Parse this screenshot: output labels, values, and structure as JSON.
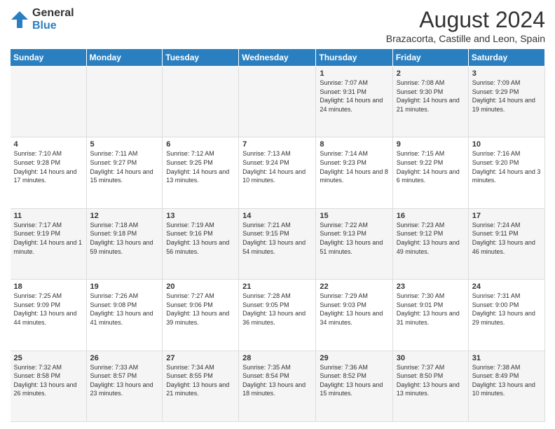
{
  "header": {
    "logo": {
      "general": "General",
      "blue": "Blue"
    },
    "title": "August 2024",
    "subtitle": "Brazacorta, Castille and Leon, Spain"
  },
  "calendar": {
    "days_of_week": [
      "Sunday",
      "Monday",
      "Tuesday",
      "Wednesday",
      "Thursday",
      "Friday",
      "Saturday"
    ],
    "weeks": [
      [
        {
          "day": "",
          "info": ""
        },
        {
          "day": "",
          "info": ""
        },
        {
          "day": "",
          "info": ""
        },
        {
          "day": "",
          "info": ""
        },
        {
          "day": "1",
          "info": "Sunrise: 7:07 AM\nSunset: 9:31 PM\nDaylight: 14 hours and 24 minutes."
        },
        {
          "day": "2",
          "info": "Sunrise: 7:08 AM\nSunset: 9:30 PM\nDaylight: 14 hours and 21 minutes."
        },
        {
          "day": "3",
          "info": "Sunrise: 7:09 AM\nSunset: 9:29 PM\nDaylight: 14 hours and 19 minutes."
        }
      ],
      [
        {
          "day": "4",
          "info": "Sunrise: 7:10 AM\nSunset: 9:28 PM\nDaylight: 14 hours and 17 minutes."
        },
        {
          "day": "5",
          "info": "Sunrise: 7:11 AM\nSunset: 9:27 PM\nDaylight: 14 hours and 15 minutes."
        },
        {
          "day": "6",
          "info": "Sunrise: 7:12 AM\nSunset: 9:25 PM\nDaylight: 14 hours and 13 minutes."
        },
        {
          "day": "7",
          "info": "Sunrise: 7:13 AM\nSunset: 9:24 PM\nDaylight: 14 hours and 10 minutes."
        },
        {
          "day": "8",
          "info": "Sunrise: 7:14 AM\nSunset: 9:23 PM\nDaylight: 14 hours and 8 minutes."
        },
        {
          "day": "9",
          "info": "Sunrise: 7:15 AM\nSunset: 9:22 PM\nDaylight: 14 hours and 6 minutes."
        },
        {
          "day": "10",
          "info": "Sunrise: 7:16 AM\nSunset: 9:20 PM\nDaylight: 14 hours and 3 minutes."
        }
      ],
      [
        {
          "day": "11",
          "info": "Sunrise: 7:17 AM\nSunset: 9:19 PM\nDaylight: 14 hours and 1 minute."
        },
        {
          "day": "12",
          "info": "Sunrise: 7:18 AM\nSunset: 9:18 PM\nDaylight: 13 hours and 59 minutes."
        },
        {
          "day": "13",
          "info": "Sunrise: 7:19 AM\nSunset: 9:16 PM\nDaylight: 13 hours and 56 minutes."
        },
        {
          "day": "14",
          "info": "Sunrise: 7:21 AM\nSunset: 9:15 PM\nDaylight: 13 hours and 54 minutes."
        },
        {
          "day": "15",
          "info": "Sunrise: 7:22 AM\nSunset: 9:13 PM\nDaylight: 13 hours and 51 minutes."
        },
        {
          "day": "16",
          "info": "Sunrise: 7:23 AM\nSunset: 9:12 PM\nDaylight: 13 hours and 49 minutes."
        },
        {
          "day": "17",
          "info": "Sunrise: 7:24 AM\nSunset: 9:11 PM\nDaylight: 13 hours and 46 minutes."
        }
      ],
      [
        {
          "day": "18",
          "info": "Sunrise: 7:25 AM\nSunset: 9:09 PM\nDaylight: 13 hours and 44 minutes."
        },
        {
          "day": "19",
          "info": "Sunrise: 7:26 AM\nSunset: 9:08 PM\nDaylight: 13 hours and 41 minutes."
        },
        {
          "day": "20",
          "info": "Sunrise: 7:27 AM\nSunset: 9:06 PM\nDaylight: 13 hours and 39 minutes."
        },
        {
          "day": "21",
          "info": "Sunrise: 7:28 AM\nSunset: 9:05 PM\nDaylight: 13 hours and 36 minutes."
        },
        {
          "day": "22",
          "info": "Sunrise: 7:29 AM\nSunset: 9:03 PM\nDaylight: 13 hours and 34 minutes."
        },
        {
          "day": "23",
          "info": "Sunrise: 7:30 AM\nSunset: 9:01 PM\nDaylight: 13 hours and 31 minutes."
        },
        {
          "day": "24",
          "info": "Sunrise: 7:31 AM\nSunset: 9:00 PM\nDaylight: 13 hours and 29 minutes."
        }
      ],
      [
        {
          "day": "25",
          "info": "Sunrise: 7:32 AM\nSunset: 8:58 PM\nDaylight: 13 hours and 26 minutes."
        },
        {
          "day": "26",
          "info": "Sunrise: 7:33 AM\nSunset: 8:57 PM\nDaylight: 13 hours and 23 minutes."
        },
        {
          "day": "27",
          "info": "Sunrise: 7:34 AM\nSunset: 8:55 PM\nDaylight: 13 hours and 21 minutes."
        },
        {
          "day": "28",
          "info": "Sunrise: 7:35 AM\nSunset: 8:54 PM\nDaylight: 13 hours and 18 minutes."
        },
        {
          "day": "29",
          "info": "Sunrise: 7:36 AM\nSunset: 8:52 PM\nDaylight: 13 hours and 15 minutes."
        },
        {
          "day": "30",
          "info": "Sunrise: 7:37 AM\nSunset: 8:50 PM\nDaylight: 13 hours and 13 minutes."
        },
        {
          "day": "31",
          "info": "Sunrise: 7:38 AM\nSunset: 8:49 PM\nDaylight: 13 hours and 10 minutes."
        }
      ]
    ]
  }
}
